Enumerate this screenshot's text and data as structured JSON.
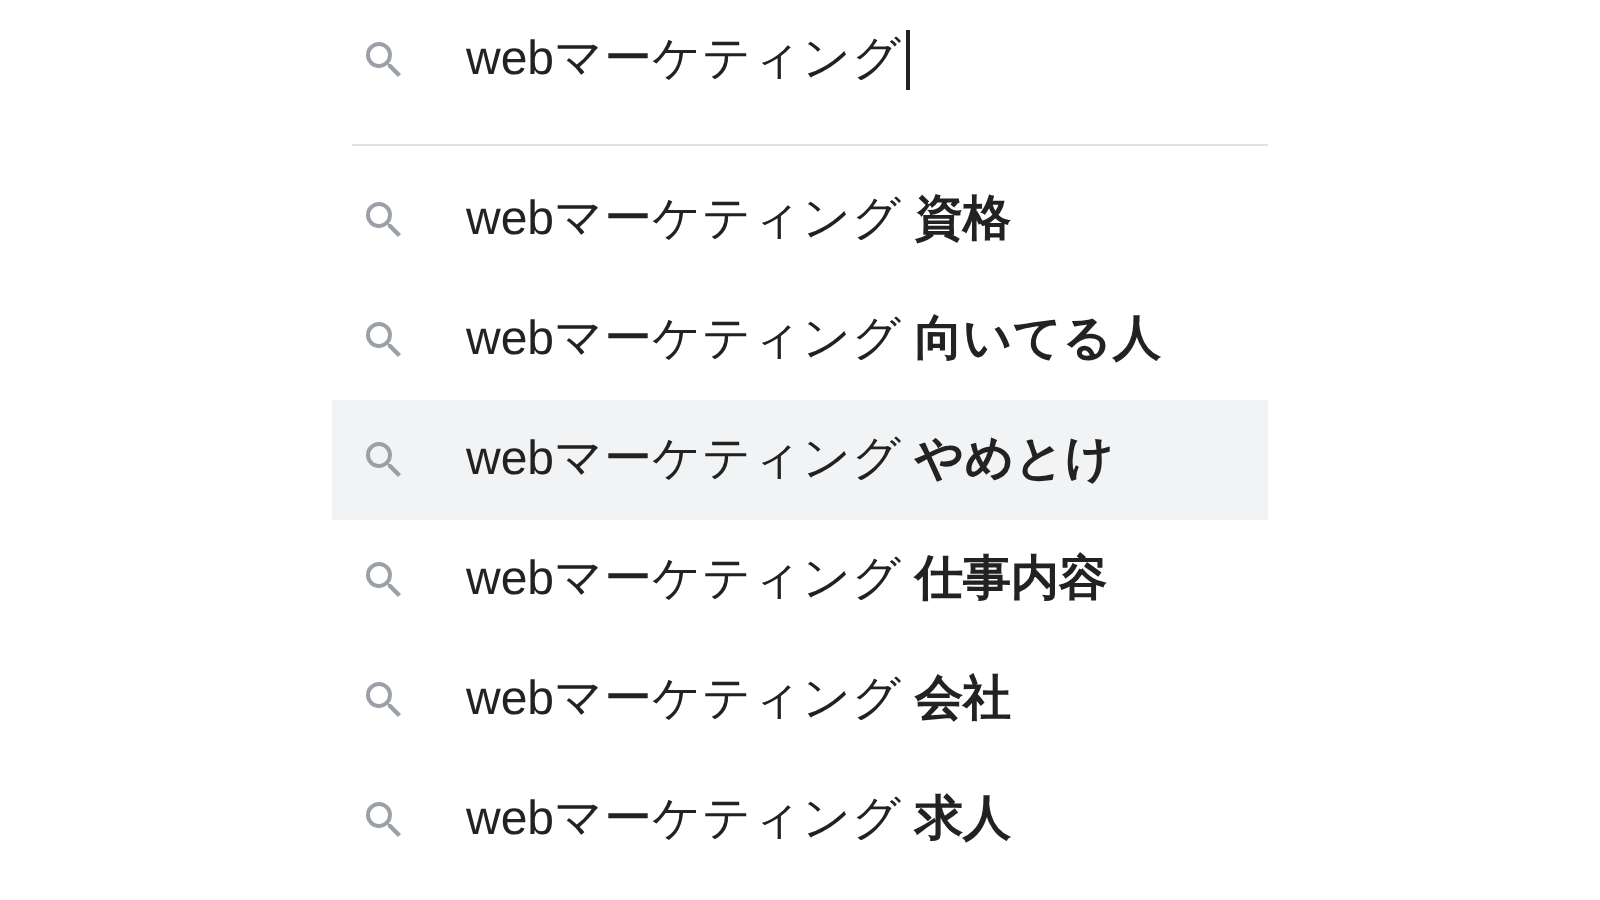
{
  "search": {
    "value": "webマーケティング"
  },
  "suggestions": [
    {
      "text": "webマーケティング **資格**",
      "selected": false
    },
    {
      "text": "webマーケティング **向いてる人**",
      "selected": false
    },
    {
      "text": "webマーケティング **やめとけ**",
      "selected": true
    },
    {
      "text": "webマーケティング **仕事内容**",
      "selected": false
    },
    {
      "text": "webマーケティング **会社**",
      "selected": false
    },
    {
      "text": "webマーケティング **求人**",
      "selected": false
    }
  ]
}
